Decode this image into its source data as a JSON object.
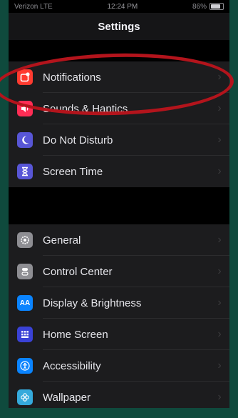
{
  "status_bar": {
    "carrier": "Verizon LTE",
    "time": "12:24 PM",
    "battery": "86%"
  },
  "nav": {
    "title": "Settings"
  },
  "groups": [
    {
      "items": [
        {
          "label": "Notifications",
          "icon": "notifications-icon",
          "color": "#ff3b30"
        },
        {
          "label": "Sounds & Haptics",
          "icon": "speaker-icon",
          "color": "#ff2d55"
        },
        {
          "label": "Do Not Disturb",
          "icon": "moon-icon",
          "color": "#5856d6"
        },
        {
          "label": "Screen Time",
          "icon": "hourglass-icon",
          "color": "#5856d6"
        }
      ]
    },
    {
      "items": [
        {
          "label": "General",
          "icon": "gear-icon",
          "color": "#8e8e93"
        },
        {
          "label": "Control Center",
          "icon": "toggles-icon",
          "color": "#8e8e93"
        },
        {
          "label": "Display & Brightness",
          "icon": "aa-icon",
          "color": "#0a84ff"
        },
        {
          "label": "Home Screen",
          "icon": "grid-icon",
          "color": "#3a42d6"
        },
        {
          "label": "Accessibility",
          "icon": "accessibility-icon",
          "color": "#0a84ff"
        },
        {
          "label": "Wallpaper",
          "icon": "flower-icon",
          "color": "#35aadc"
        }
      ]
    }
  ],
  "annotation": {
    "color": "#b3141c"
  }
}
